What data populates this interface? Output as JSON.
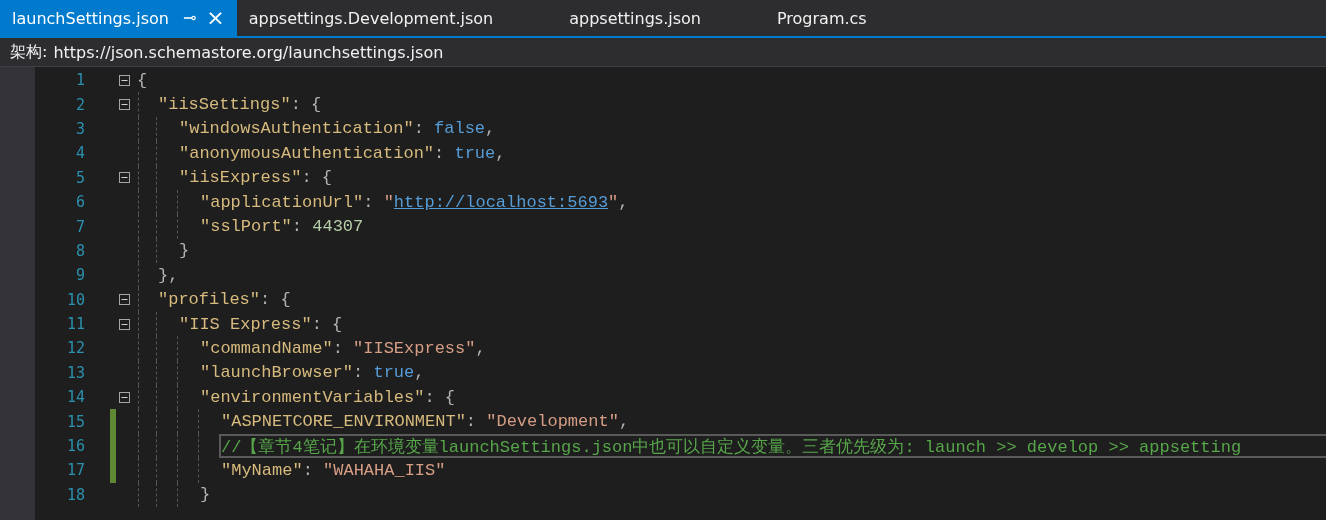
{
  "tabs": [
    {
      "label": "launchSettings.json",
      "selected": true,
      "pin": "⊸",
      "close": "×"
    },
    {
      "label": "appsettings.Development.json",
      "selected": false
    },
    {
      "label": "appsettings.json",
      "selected": false
    },
    {
      "label": "Program.cs",
      "selected": false
    }
  ],
  "schema_bar": {
    "label": "架构:",
    "value": "https://json.schemastore.org/launchsettings.json"
  },
  "lines": [
    {
      "number": "1",
      "expanded": true,
      "changed": false,
      "current": false,
      "tokens": [
        {
          "kind": "punct",
          "text": "{"
        }
      ],
      "children": [
        {
          "number": "2",
          "expanded": true,
          "changed": false,
          "current": false,
          "tokens": [
            {
              "kind": "key",
              "text": "\"iisSettings\""
            },
            {
              "kind": "punct",
              "text": ": {"
            }
          ],
          "children": [
            {
              "number": "3",
              "changed": false,
              "current": false,
              "tokens": [
                {
                  "kind": "key",
                  "text": "\"windowsAuthentication\""
                },
                {
                  "kind": "punct",
                  "text": ": "
                },
                {
                  "kind": "keyword",
                  "text": "false"
                },
                {
                  "kind": "punct",
                  "text": ","
                }
              ]
            },
            {
              "number": "4",
              "changed": false,
              "current": false,
              "tokens": [
                {
                  "kind": "key",
                  "text": "\"anonymousAuthentication\""
                },
                {
                  "kind": "punct",
                  "text": ": "
                },
                {
                  "kind": "keyword",
                  "text": "true"
                },
                {
                  "kind": "punct",
                  "text": ","
                }
              ]
            },
            {
              "number": "5",
              "expanded": true,
              "changed": false,
              "current": false,
              "tokens": [
                {
                  "kind": "key",
                  "text": "\"iisExpress\""
                },
                {
                  "kind": "punct",
                  "text": ": {"
                }
              ],
              "children": [
                {
                  "number": "6",
                  "changed": false,
                  "current": false,
                  "tokens": [
                    {
                      "kind": "key",
                      "text": "\"applicationUrl\""
                    },
                    {
                      "kind": "punct",
                      "text": ": "
                    },
                    {
                      "kind": "string",
                      "text": "\""
                    },
                    {
                      "kind": "link",
                      "text": "http://localhost:5693"
                    },
                    {
                      "kind": "string",
                      "text": "\""
                    },
                    {
                      "kind": "punct",
                      "text": ","
                    }
                  ]
                },
                {
                  "number": "7",
                  "changed": false,
                  "current": false,
                  "tokens": [
                    {
                      "kind": "key",
                      "text": "\"sslPort\""
                    },
                    {
                      "kind": "punct",
                      "text": ": "
                    },
                    {
                      "kind": "number",
                      "text": "44307"
                    }
                  ]
                }
              ]
            },
            {
              "number": "8",
              "changed": false,
              "current": false,
              "tokens": [
                {
                  "kind": "punct",
                  "text": "}"
                }
              ]
            }
          ]
        },
        {
          "number": "9",
          "changed": false,
          "current": false,
          "tokens": [
            {
              "kind": "punct",
              "text": "},"
            }
          ]
        },
        {
          "number": "10",
          "expanded": true,
          "changed": false,
          "current": false,
          "tokens": [
            {
              "kind": "key",
              "text": "\"profiles\""
            },
            {
              "kind": "punct",
              "text": ": {"
            }
          ],
          "children": [
            {
              "number": "11",
              "expanded": true,
              "changed": false,
              "current": false,
              "tokens": [
                {
                  "kind": "key",
                  "text": "\"IIS Express\""
                },
                {
                  "kind": "punct",
                  "text": ": {"
                }
              ],
              "children": [
                {
                  "number": "12",
                  "changed": false,
                  "current": false,
                  "tokens": [
                    {
                      "kind": "key",
                      "text": "\"commandName\""
                    },
                    {
                      "kind": "punct",
                      "text": ": "
                    },
                    {
                      "kind": "string",
                      "text": "\"IISExpress\""
                    },
                    {
                      "kind": "punct",
                      "text": ","
                    }
                  ]
                },
                {
                  "number": "13",
                  "changed": false,
                  "current": false,
                  "tokens": [
                    {
                      "kind": "key",
                      "text": "\"launchBrowser\""
                    },
                    {
                      "kind": "punct",
                      "text": ": "
                    },
                    {
                      "kind": "keyword",
                      "text": "true"
                    },
                    {
                      "kind": "punct",
                      "text": ","
                    }
                  ]
                },
                {
                  "number": "14",
                  "expanded": true,
                  "changed": false,
                  "current": false,
                  "tokens": [
                    {
                      "kind": "key",
                      "text": "\"environmentVariables\""
                    },
                    {
                      "kind": "punct",
                      "text": ": {"
                    }
                  ],
                  "children": [
                    {
                      "number": "15",
                      "changed": true,
                      "current": false,
                      "tokens": [
                        {
                          "kind": "key",
                          "text": "\"ASPNETCORE_ENVIRONMENT\""
                        },
                        {
                          "kind": "punct",
                          "text": ": "
                        },
                        {
                          "kind": "string",
                          "text": "\"Development\""
                        },
                        {
                          "kind": "punct",
                          "text": ","
                        }
                      ]
                    },
                    {
                      "number": "16",
                      "changed": true,
                      "current": true,
                      "tokens": [
                        {
                          "kind": "comment",
                          "text": "//【章节4笔记】在环境变量launchSettings.json中也可以自定义变量。三者优先级为: launch >> develop >> appsetting"
                        }
                      ]
                    },
                    {
                      "number": "17",
                      "changed": true,
                      "current": false,
                      "tokens": [
                        {
                          "kind": "key",
                          "text": "\"MyName\""
                        },
                        {
                          "kind": "punct",
                          "text": ": "
                        },
                        {
                          "kind": "string",
                          "text": "\"WAHAHA_IIS\""
                        }
                      ]
                    }
                  ]
                },
                {
                  "number": "18",
                  "changed": false,
                  "current": false,
                  "tokens": [
                    {
                      "kind": "punct",
                      "text": "}"
                    }
                  ]
                }
              ]
            }
          ]
        }
      ]
    }
  ]
}
